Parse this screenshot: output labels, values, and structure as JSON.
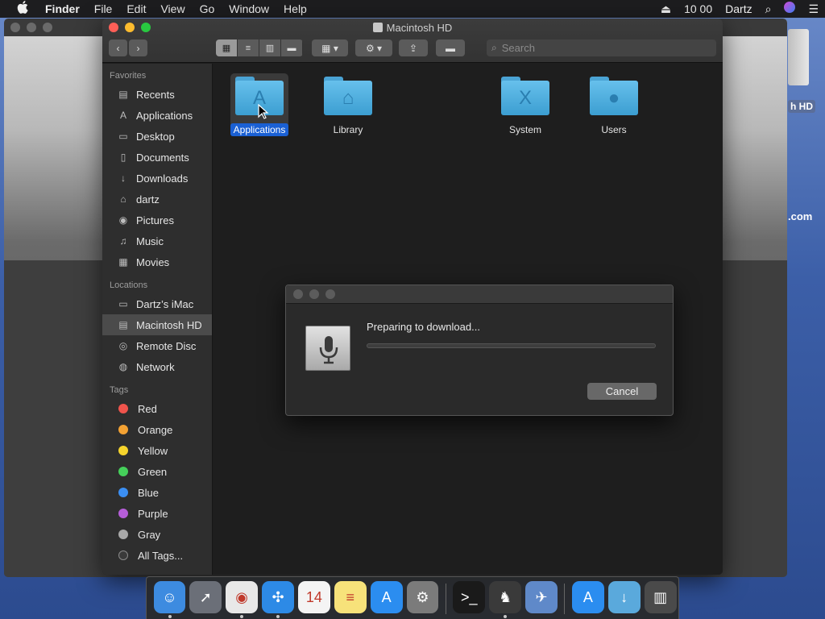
{
  "menubar": {
    "apple": "",
    "app": "Finder",
    "items": [
      "File",
      "Edit",
      "View",
      "Go",
      "Window",
      "Help"
    ],
    "clock": "10 00",
    "user": "Dartz"
  },
  "desktop": {
    "hd_label": "h HD",
    "com_label": ".com"
  },
  "window": {
    "title": "Macintosh HD"
  },
  "search": {
    "placeholder": "Search"
  },
  "sidebar": {
    "favorites_header": "Favorites",
    "favorites": [
      {
        "label": "Recents",
        "icon": "▤"
      },
      {
        "label": "Applications",
        "icon": "A"
      },
      {
        "label": "Desktop",
        "icon": "▭"
      },
      {
        "label": "Documents",
        "icon": "▯"
      },
      {
        "label": "Downloads",
        "icon": "↓"
      },
      {
        "label": "dartz",
        "icon": "⌂"
      },
      {
        "label": "Pictures",
        "icon": "◉"
      },
      {
        "label": "Music",
        "icon": "♫"
      },
      {
        "label": "Movies",
        "icon": "▦"
      }
    ],
    "locations_header": "Locations",
    "locations": [
      {
        "label": "Dartz’s iMac",
        "icon": "▭"
      },
      {
        "label": "Macintosh HD",
        "icon": "▤",
        "selected": true
      },
      {
        "label": "Remote Disc",
        "icon": "◎"
      },
      {
        "label": "Network",
        "icon": "◍"
      }
    ],
    "tags_header": "Tags",
    "tags": [
      {
        "label": "Red",
        "color": "#f0544c"
      },
      {
        "label": "Orange",
        "color": "#f3a233"
      },
      {
        "label": "Yellow",
        "color": "#f6d42c"
      },
      {
        "label": "Green",
        "color": "#45d05a"
      },
      {
        "label": "Blue",
        "color": "#3b8ff3"
      },
      {
        "label": "Purple",
        "color": "#b65ed9"
      },
      {
        "label": "Gray",
        "color": "#a8a8a8"
      },
      {
        "label": "All Tags...",
        "color": "#3a3a3a"
      }
    ]
  },
  "files": [
    {
      "name": "Applications",
      "glyph": "A",
      "selected": true
    },
    {
      "name": "Library",
      "glyph": "⌂"
    },
    {
      "name": "System",
      "glyph": "X"
    },
    {
      "name": "Users",
      "glyph": "●"
    }
  ],
  "dialog": {
    "message": "Preparing to download...",
    "progress": 0,
    "cancel_label": "Cancel"
  },
  "dock": [
    {
      "name": "finder-icon",
      "bg": "#3d8be0",
      "glyph": "☺",
      "running": true
    },
    {
      "name": "launchpad-icon",
      "bg": "#6b6f78",
      "glyph": "➚"
    },
    {
      "name": "chrome-icon",
      "bg": "#e8e8e8",
      "glyph": "◉",
      "running": true
    },
    {
      "name": "safari-icon",
      "bg": "#2d8ae6",
      "glyph": "✣",
      "running": true
    },
    {
      "name": "calendar-icon",
      "bg": "#f4f4f4",
      "glyph": "14"
    },
    {
      "name": "notes-icon",
      "bg": "#f7e27a",
      "glyph": "≡"
    },
    {
      "name": "app-store-icon",
      "bg": "#2b8df0",
      "glyph": "A"
    },
    {
      "name": "system-preferences-icon",
      "bg": "#7b7b7b",
      "glyph": "⚙"
    },
    {
      "name": "terminal-icon",
      "bg": "#1a1a1a",
      "glyph": ">_"
    },
    {
      "name": "chess-icon",
      "bg": "#3a3a3a",
      "glyph": "♞",
      "running": true
    },
    {
      "name": "preview-icon",
      "bg": "#5f89c9",
      "glyph": "✈"
    },
    {
      "name": "app-store-install-icon",
      "bg": "#2b8df0",
      "glyph": "A"
    },
    {
      "name": "downloads-folder-icon",
      "bg": "#5aa9dc",
      "glyph": "↓"
    },
    {
      "name": "trash-icon",
      "bg": "#4a4a4a",
      "glyph": "▥"
    }
  ]
}
